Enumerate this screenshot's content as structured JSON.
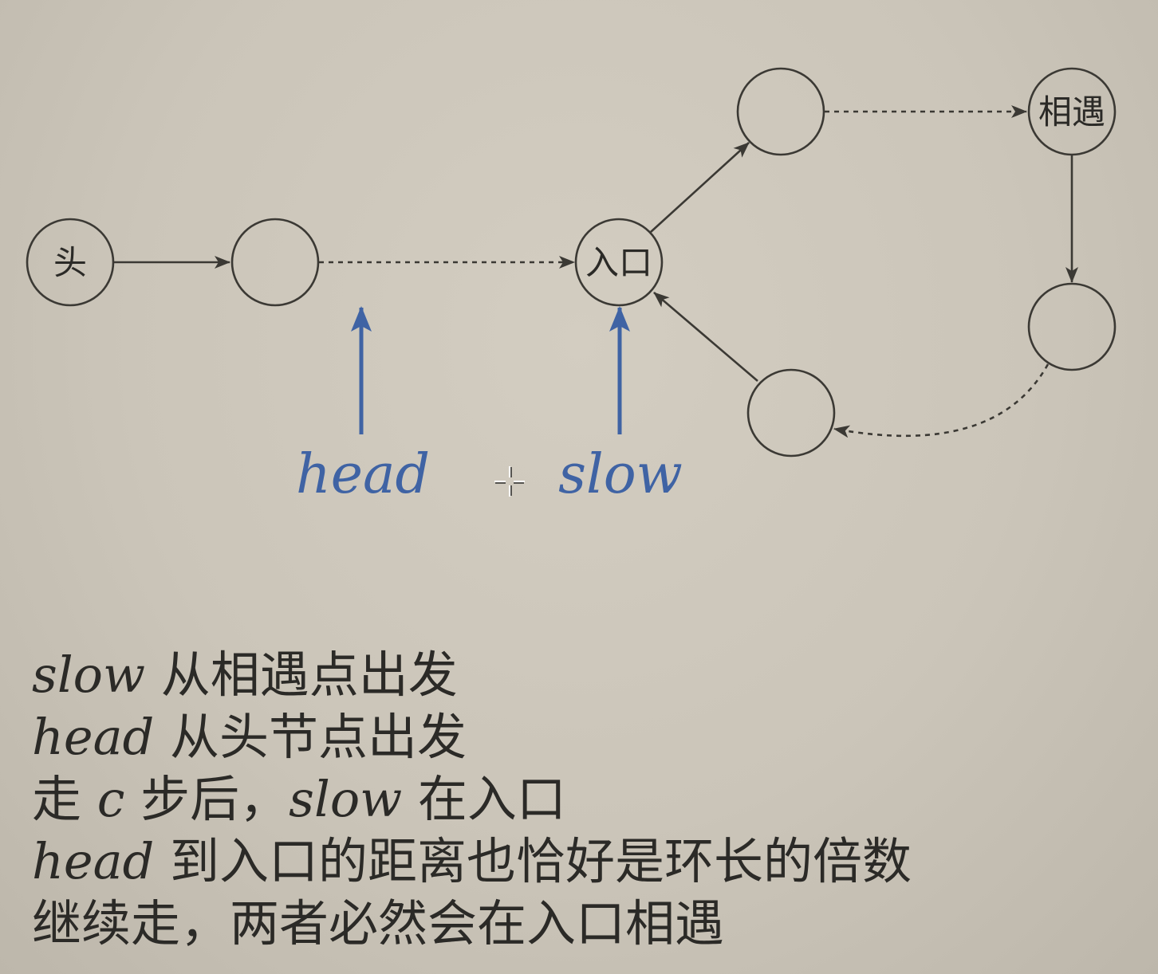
{
  "diagram": {
    "nodes": [
      {
        "id": "head-node",
        "label": "头"
      },
      {
        "id": "node-1",
        "label": ""
      },
      {
        "id": "entry-node",
        "label": "入口"
      },
      {
        "id": "node-top",
        "label": ""
      },
      {
        "id": "meet-node",
        "label": "相遇"
      },
      {
        "id": "node-right",
        "label": ""
      },
      {
        "id": "node-bottom",
        "label": ""
      }
    ],
    "edges": [
      {
        "from": "head-node",
        "to": "node-1",
        "style": "solid"
      },
      {
        "from": "node-1",
        "to": "entry-node",
        "style": "dashed"
      },
      {
        "from": "entry-node",
        "to": "node-top",
        "style": "solid"
      },
      {
        "from": "node-top",
        "to": "meet-node",
        "style": "dashed"
      },
      {
        "from": "meet-node",
        "to": "node-right",
        "style": "solid"
      },
      {
        "from": "node-right",
        "to": "node-bottom",
        "style": "dashed"
      },
      {
        "from": "node-bottom",
        "to": "entry-node",
        "style": "solid"
      }
    ],
    "pointers": {
      "head": "head",
      "slow": "slow"
    }
  },
  "caption": {
    "line1": {
      "math": "slow",
      "text": " 从相遇点出发"
    },
    "line2": {
      "math": "head",
      "text": " 从头节点出发"
    },
    "line3": {
      "pre": "走 ",
      "math1": "c",
      "mid": " 步后，",
      "math2": "slow",
      "post": " 在入口"
    },
    "line4": {
      "math": "head",
      "text": " 到入口的距离也恰好是环长的倍数"
    },
    "line5": {
      "text": "继续走，两者必然会在入口相遇"
    }
  },
  "colors": {
    "node_stroke": "#3b3934",
    "pointer_blue": "#3f63a4",
    "text": "#2b2a27"
  }
}
